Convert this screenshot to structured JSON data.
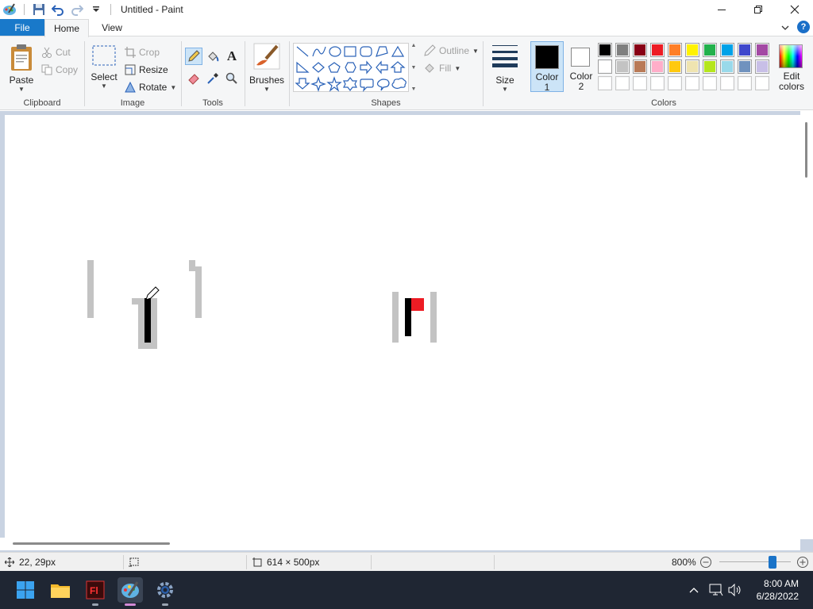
{
  "window": {
    "title": "Untitled - Paint"
  },
  "tabs": {
    "file": "File",
    "home": "Home",
    "view": "View",
    "help": "?"
  },
  "clipboard": {
    "paste": "Paste",
    "cut": "Cut",
    "copy": "Copy",
    "label": "Clipboard"
  },
  "image": {
    "select": "Select",
    "crop": "Crop",
    "resize": "Resize",
    "rotate": "Rotate",
    "label": "Image"
  },
  "tools": {
    "label": "Tools",
    "text_glyph": "A"
  },
  "brushes": {
    "label": "Brushes"
  },
  "shapes": {
    "outline": "Outline",
    "fill": "Fill",
    "label": "Shapes"
  },
  "size": {
    "label": "Size"
  },
  "colors": {
    "color1_line1": "Color",
    "color1_line2": "1",
    "color2_line1": "Color",
    "color2_line2": "2",
    "edit_line1": "Edit",
    "edit_line2": "colors",
    "label": "Colors",
    "color1_value": "#000000",
    "color2_value": "#ffffff",
    "palette_row1": [
      "#000000",
      "#7f7f7f",
      "#880015",
      "#ed1c24",
      "#ff7f27",
      "#fff200",
      "#22b14c",
      "#00a2e8",
      "#3f48cc",
      "#a349a4"
    ],
    "palette_row2": [
      "#ffffff",
      "#c3c3c3",
      "#b97a57",
      "#ffaec9",
      "#ffc90e",
      "#efe4b0",
      "#b5e61d",
      "#99d9ea",
      "#7092be",
      "#c8bfe7"
    ],
    "palette_row3": [
      "#ffffff",
      "#ffffff",
      "#ffffff",
      "#ffffff",
      "#ffffff",
      "#ffffff",
      "#ffffff",
      "#ffffff",
      "#ffffff",
      "#ffffff"
    ]
  },
  "status": {
    "cursor_pos": "22, 29px",
    "canvas_size": "614 × 500px",
    "zoom": "800%",
    "zoom_slider_fraction": 0.78
  },
  "taskbar": {
    "time": "8:00 AM",
    "date": "6/28/2022",
    "apps": [
      "start-icon",
      "file-explorer-icon",
      "flash-icon",
      "paint-icon",
      "settings-icon"
    ]
  }
}
